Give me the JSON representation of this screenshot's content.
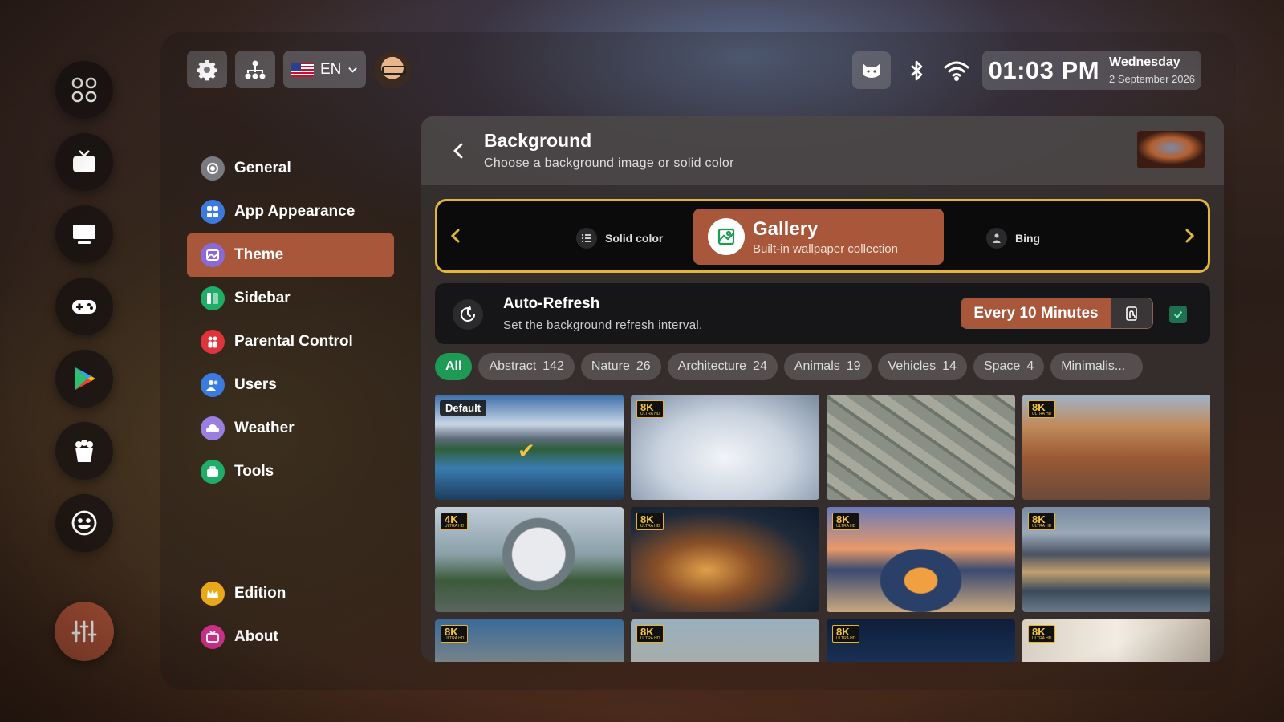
{
  "topbar": {
    "language": "EN",
    "clock_time": "01:03 PM",
    "clock_day": "Wednesday",
    "clock_date": "2 September 2026"
  },
  "rail": {
    "icons": [
      "apps-icon",
      "tv-icon",
      "monitor-icon",
      "gamepad-icon",
      "play-store-icon",
      "popcorn-icon",
      "smiley-icon",
      "sliders-icon"
    ]
  },
  "nav": {
    "items": [
      {
        "label": "General",
        "color": "#7a7a80"
      },
      {
        "label": "App Appearance",
        "color": "#3a7be0"
      },
      {
        "label": "Theme",
        "color": "#8a6ad8"
      },
      {
        "label": "Sidebar",
        "color": "#1fae6a"
      },
      {
        "label": "Parental Control",
        "color": "#e0343c"
      },
      {
        "label": "Users",
        "color": "#3a7be0"
      },
      {
        "label": "Weather",
        "color": "#9b7fe0"
      },
      {
        "label": "Tools",
        "color": "#1fae6a"
      },
      {
        "label": "Edition",
        "color": "#e8a81a"
      },
      {
        "label": "About",
        "color": "#d6338f"
      }
    ]
  },
  "panel": {
    "title": "Background",
    "subtitle": "Choose a background image or solid color"
  },
  "source": {
    "solid_label": "Solid color",
    "active_title": "Gallery",
    "active_sub": "Built-in wallpaper collection",
    "bing_label": "Bing"
  },
  "refresh": {
    "title": "Auto-Refresh",
    "subtitle": "Set the background refresh interval.",
    "interval": "Every 10 Minutes",
    "enabled": true
  },
  "filters": [
    {
      "label": "All",
      "count": ""
    },
    {
      "label": "Abstract",
      "count": "142"
    },
    {
      "label": "Nature",
      "count": "26"
    },
    {
      "label": "Architecture",
      "count": "24"
    },
    {
      "label": "Animals",
      "count": "19"
    },
    {
      "label": "Vehicles",
      "count": "14"
    },
    {
      "label": "Space",
      "count": "4"
    },
    {
      "label": "Minimalis...",
      "count": ""
    }
  ],
  "gallery": [
    {
      "tag": "Default",
      "badge": "",
      "selected": true
    },
    {
      "tag": "",
      "badge": "8K",
      "selected": false
    },
    {
      "tag": "",
      "badge": "",
      "selected": false
    },
    {
      "tag": "",
      "badge": "8K",
      "selected": false
    },
    {
      "tag": "",
      "badge": "4K",
      "selected": false
    },
    {
      "tag": "",
      "badge": "8K",
      "selected": false
    },
    {
      "tag": "",
      "badge": "8K",
      "selected": false
    },
    {
      "tag": "",
      "badge": "8K",
      "selected": false
    },
    {
      "tag": "",
      "badge": "8K",
      "selected": false
    },
    {
      "tag": "",
      "badge": "8K",
      "selected": false
    },
    {
      "tag": "",
      "badge": "8K",
      "selected": false
    },
    {
      "tag": "",
      "badge": "8K",
      "selected": false
    }
  ],
  "badge_sub": "ULTRA HD",
  "accent": "#a9573a",
  "highlight": "#e2b63a",
  "active_filter_color": "#1e9a55"
}
